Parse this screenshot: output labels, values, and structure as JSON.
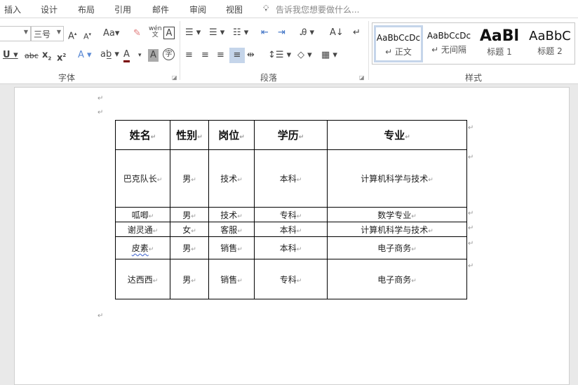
{
  "menu": {
    "items": [
      "插入",
      "设计",
      "布局",
      "引用",
      "邮件",
      "审阅",
      "视图"
    ],
    "tell_me": "告诉我您想要做什么..."
  },
  "font": {
    "size": "三号",
    "group_label": "字体"
  },
  "paragraph": {
    "group_label": "段落"
  },
  "styles": {
    "group_label": "样式",
    "items": [
      {
        "preview": "AaBbCcDc",
        "name": "↵ 正文"
      },
      {
        "preview": "AaBbCcDc",
        "name": "↵ 无间隔"
      },
      {
        "preview": "AaBl",
        "name": "标题 1"
      },
      {
        "preview": "AaBbC",
        "name": "标题 2"
      }
    ]
  },
  "table": {
    "headers": [
      "姓名",
      "性别",
      "岗位",
      "学历",
      "专业"
    ],
    "rows": [
      [
        "巴克队长",
        "男",
        "技术",
        "本科",
        "计算机科学与技术"
      ],
      [
        "呱唧",
        "男",
        "技术",
        "专科",
        "数学专业"
      ],
      [
        "谢灵通",
        "女",
        "客服",
        "本科",
        "计算机科学与技术"
      ],
      [
        "皮素",
        "男",
        "销售",
        "本科",
        "电子商务"
      ],
      [
        "达西西",
        "男",
        "销售",
        "专科",
        "电子商务"
      ]
    ]
  },
  "marks": {
    "para": "↵",
    "cell": "↵"
  },
  "colors": {
    "selected_style_border": "#c5d5ea",
    "active_align_bg": "#c5d5ea",
    "font_color_bar": "#7a0000"
  }
}
